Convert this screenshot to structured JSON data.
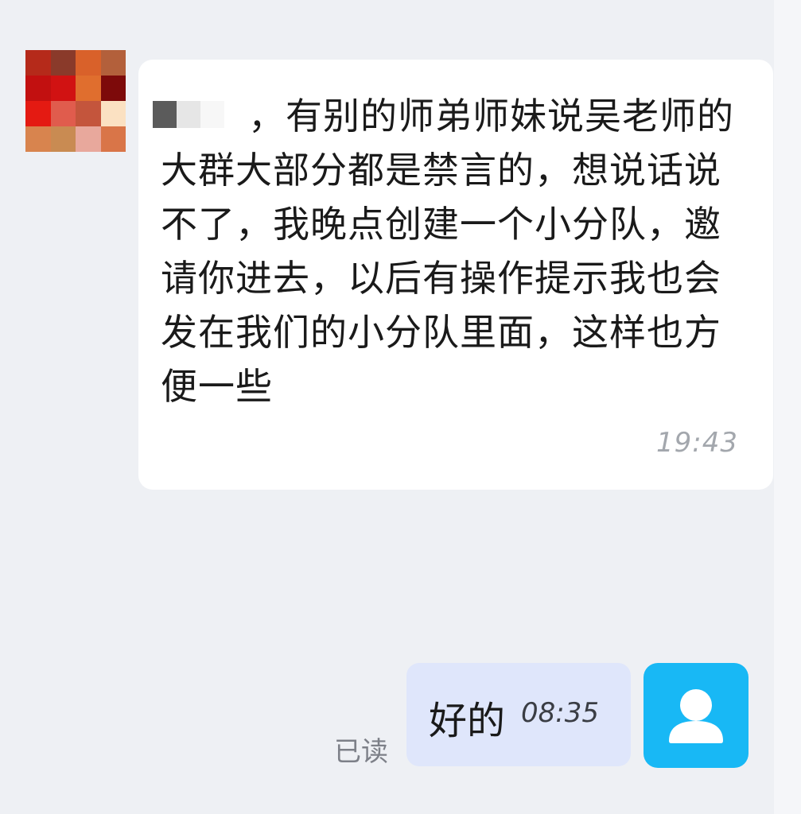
{
  "chat": {
    "incoming": {
      "sender_name_redacted": true,
      "text": "，有别的师弟师妹说吴老师的大群大部分都是禁言的，想说话说不了，我晚点创建一个小分队，邀请你进去，以后有操作提示我也会发在我们的小分队里面，这样也方便一些",
      "time": "19:43"
    },
    "outgoing": {
      "text": "好的",
      "time": "08:35",
      "read_status": "已读"
    }
  },
  "avatar_mosaic_colors": [
    "#b52a1a",
    "#8a3a2a",
    "#d9612a",
    "#b3603b",
    "#c21010",
    "#d11212",
    "#e06e2e",
    "#7d0a0a",
    "#e41a12",
    "#e05c4d",
    "#c4553c",
    "#fbe1c2",
    "#d8844e",
    "#c98b52",
    "#e8a89c",
    "#d97548"
  ],
  "icons": {
    "self_avatar": "user-silhouette-icon"
  },
  "colors": {
    "background": "#eef0f4",
    "incoming_bubble": "#ffffff",
    "outgoing_bubble": "#dfe6fb",
    "self_avatar": "#18b8f5"
  }
}
